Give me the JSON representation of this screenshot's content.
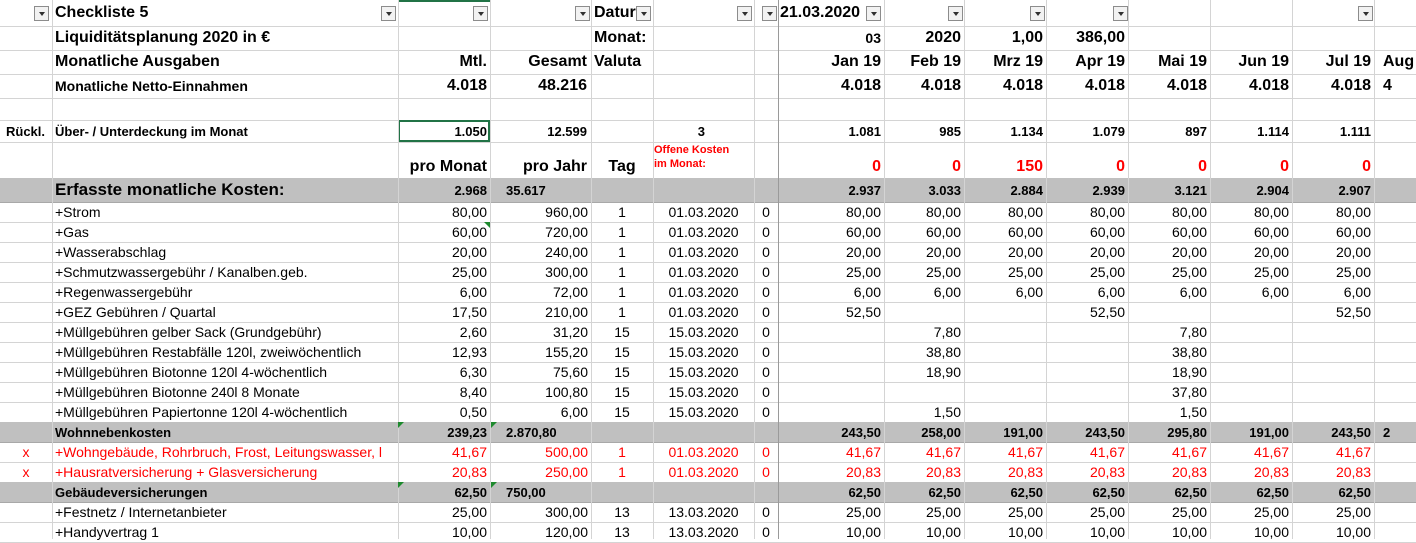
{
  "header": {
    "title": "Checkliste 5",
    "datum_label": "Datur",
    "date_value": "21.03.2020",
    "subtitle": "Liquiditätsplanung 2020 in €",
    "monat_label": "Monat:",
    "month_num": "03",
    "year": "2020",
    "factor": "1,00",
    "amount": "386,00",
    "section_label": "Monatliche Ausgaben",
    "col_mtl": "Mtl.",
    "col_gesamt": "Gesamt",
    "col_valuta": "Valuta",
    "months": [
      "Jan 19",
      "Feb 19",
      "Mrz 19",
      "Apr 19",
      "Mai 19",
      "Jun 19",
      "Jul 19",
      "Aug"
    ]
  },
  "income": {
    "label": "Monatliche Netto-Einnahmen",
    "mtl": "4.018",
    "gesamt": "48.216",
    "months": [
      "4.018",
      "4.018",
      "4.018",
      "4.018",
      "4.018",
      "4.018",
      "4.018",
      "4"
    ]
  },
  "balance": {
    "prefix": "Rückl.",
    "label": "Über- / Unterdeckung im Monat",
    "mtl": "1.050",
    "gesamt": "12.599",
    "tag": "3",
    "months": [
      "1.081",
      "985",
      "1.134",
      "1.079",
      "897",
      "1.114",
      "1.111",
      ""
    ]
  },
  "subheader": {
    "pro_monat": "pro Monat",
    "pro_jahr": "pro Jahr",
    "tag": "Tag",
    "open_costs_line1": "Offene Kosten",
    "open_costs_line2": "im Monat:",
    "months": [
      "0",
      "0",
      "150",
      "0",
      "0",
      "0",
      "0",
      ""
    ]
  },
  "costs_header": {
    "label": "Erfasste monatliche Kosten:",
    "mtl": "2.968",
    "gesamt": "35.617",
    "months": [
      "2.937",
      "3.033",
      "2.884",
      "2.939",
      "3.121",
      "2.904",
      "2.907",
      ""
    ]
  },
  "rows": [
    {
      "mark": "",
      "label": "+Strom",
      "mtl": "80,00",
      "gesamt": "960,00",
      "tag": "1",
      "date": "01.03.2020",
      "flag": "0",
      "months": [
        "80,00",
        "80,00",
        "80,00",
        "80,00",
        "80,00",
        "80,00",
        "80,00",
        ""
      ],
      "style": ""
    },
    {
      "mark": "",
      "label": "+Gas",
      "mtl": "60,00",
      "gesamt": "720,00",
      "tag": "1",
      "date": "01.03.2020",
      "flag": "0",
      "months": [
        "60,00",
        "60,00",
        "60,00",
        "60,00",
        "60,00",
        "60,00",
        "60,00",
        ""
      ],
      "style": ""
    },
    {
      "mark": "",
      "label": "+Wasserabschlag",
      "mtl": "20,00",
      "gesamt": "240,00",
      "tag": "1",
      "date": "01.03.2020",
      "flag": "0",
      "months": [
        "20,00",
        "20,00",
        "20,00",
        "20,00",
        "20,00",
        "20,00",
        "20,00",
        ""
      ],
      "style": ""
    },
    {
      "mark": "",
      "label": "+Schmutzwassergebühr / Kanalben.geb.",
      "mtl": "25,00",
      "gesamt": "300,00",
      "tag": "1",
      "date": "01.03.2020",
      "flag": "0",
      "months": [
        "25,00",
        "25,00",
        "25,00",
        "25,00",
        "25,00",
        "25,00",
        "25,00",
        ""
      ],
      "style": ""
    },
    {
      "mark": "",
      "label": "+Regenwassergebühr",
      "mtl": "6,00",
      "gesamt": "72,00",
      "tag": "1",
      "date": "01.03.2020",
      "flag": "0",
      "months": [
        "6,00",
        "6,00",
        "6,00",
        "6,00",
        "6,00",
        "6,00",
        "6,00",
        ""
      ],
      "style": ""
    },
    {
      "mark": "",
      "label": "+GEZ Gebühren / Quartal",
      "mtl": "17,50",
      "gesamt": "210,00",
      "tag": "1",
      "date": "01.03.2020",
      "flag": "0",
      "months": [
        "52,50",
        "",
        "",
        "52,50",
        "",
        "",
        "52,50",
        ""
      ],
      "style": ""
    },
    {
      "mark": "",
      "label": "+Müllgebühren gelber Sack (Grundgebühr)",
      "mtl": "2,60",
      "gesamt": "31,20",
      "tag": "15",
      "date": "15.03.2020",
      "flag": "0",
      "months": [
        "",
        "7,80",
        "",
        "",
        "7,80",
        "",
        "",
        ""
      ],
      "style": ""
    },
    {
      "mark": "",
      "label": "+Müllgebühren Restabfälle 120l, zweiwöchentlich",
      "mtl": "12,93",
      "gesamt": "155,20",
      "tag": "15",
      "date": "15.03.2020",
      "flag": "0",
      "months": [
        "",
        "38,80",
        "",
        "",
        "38,80",
        "",
        "",
        ""
      ],
      "style": ""
    },
    {
      "mark": "",
      "label": "+Müllgebühren Biotonne 120l 4-wöchentlich",
      "mtl": "6,30",
      "gesamt": "75,60",
      "tag": "15",
      "date": "15.03.2020",
      "flag": "0",
      "months": [
        "",
        "18,90",
        "",
        "",
        "18,90",
        "",
        "",
        ""
      ],
      "style": ""
    },
    {
      "mark": "",
      "label": "+Müllgebühren Biotonne 240l 8 Monate",
      "mtl": "8,40",
      "gesamt": "100,80",
      "tag": "15",
      "date": "15.03.2020",
      "flag": "0",
      "months": [
        "",
        "",
        "",
        "",
        "37,80",
        "",
        "",
        ""
      ],
      "style": ""
    },
    {
      "mark": "",
      "label": "+Müllgebühren Papiertonne 120l 4-wöchentlich",
      "mtl": "0,50",
      "gesamt": "6,00",
      "tag": "15",
      "date": "15.03.2020",
      "flag": "0",
      "months": [
        "",
        "1,50",
        "",
        "",
        "1,50",
        "",
        "",
        ""
      ],
      "style": ""
    },
    {
      "mark": "",
      "label": "Wohnnebenkosten",
      "mtl": "239,23",
      "gesamt": "2.870,80",
      "tag": "",
      "date": "",
      "flag": "",
      "months": [
        "243,50",
        "258,00",
        "191,00",
        "243,50",
        "295,80",
        "191,00",
        "243,50",
        "2"
      ],
      "style": "sum"
    },
    {
      "mark": "x",
      "label": "+Wohngebäude, Rohrbruch, Frost, Leitungswasser, l",
      "mtl": "41,67",
      "gesamt": "500,00",
      "tag": "1",
      "date": "01.03.2020",
      "flag": "0",
      "months": [
        "41,67",
        "41,67",
        "41,67",
        "41,67",
        "41,67",
        "41,67",
        "41,67",
        ""
      ],
      "style": "red"
    },
    {
      "mark": "x",
      "label": "+Hausratversicherung + Glasversicherung",
      "mtl": "20,83",
      "gesamt": "250,00",
      "tag": "1",
      "date": "01.03.2020",
      "flag": "0",
      "months": [
        "20,83",
        "20,83",
        "20,83",
        "20,83",
        "20,83",
        "20,83",
        "20,83",
        ""
      ],
      "style": "red"
    },
    {
      "mark": "",
      "label": "Gebäudeversicherungen",
      "mtl": "62,50",
      "gesamt": "750,00",
      "tag": "",
      "date": "",
      "flag": "",
      "months": [
        "62,50",
        "62,50",
        "62,50",
        "62,50",
        "62,50",
        "62,50",
        "62,50",
        ""
      ],
      "style": "sum"
    },
    {
      "mark": "",
      "label": "+Festnetz / Internetanbieter",
      "mtl": "25,00",
      "gesamt": "300,00",
      "tag": "13",
      "date": "13.03.2020",
      "flag": "0",
      "months": [
        "25,00",
        "25,00",
        "25,00",
        "25,00",
        "25,00",
        "25,00",
        "25,00",
        ""
      ],
      "style": ""
    },
    {
      "mark": "",
      "label": "+Handyvertrag 1",
      "mtl": "10,00",
      "gesamt": "120,00",
      "tag": "13",
      "date": "13.03.2020",
      "flag": "0",
      "months": [
        "10,00",
        "10,00",
        "10,00",
        "10,00",
        "10,00",
        "10,00",
        "10,00",
        ""
      ],
      "style": ""
    }
  ]
}
